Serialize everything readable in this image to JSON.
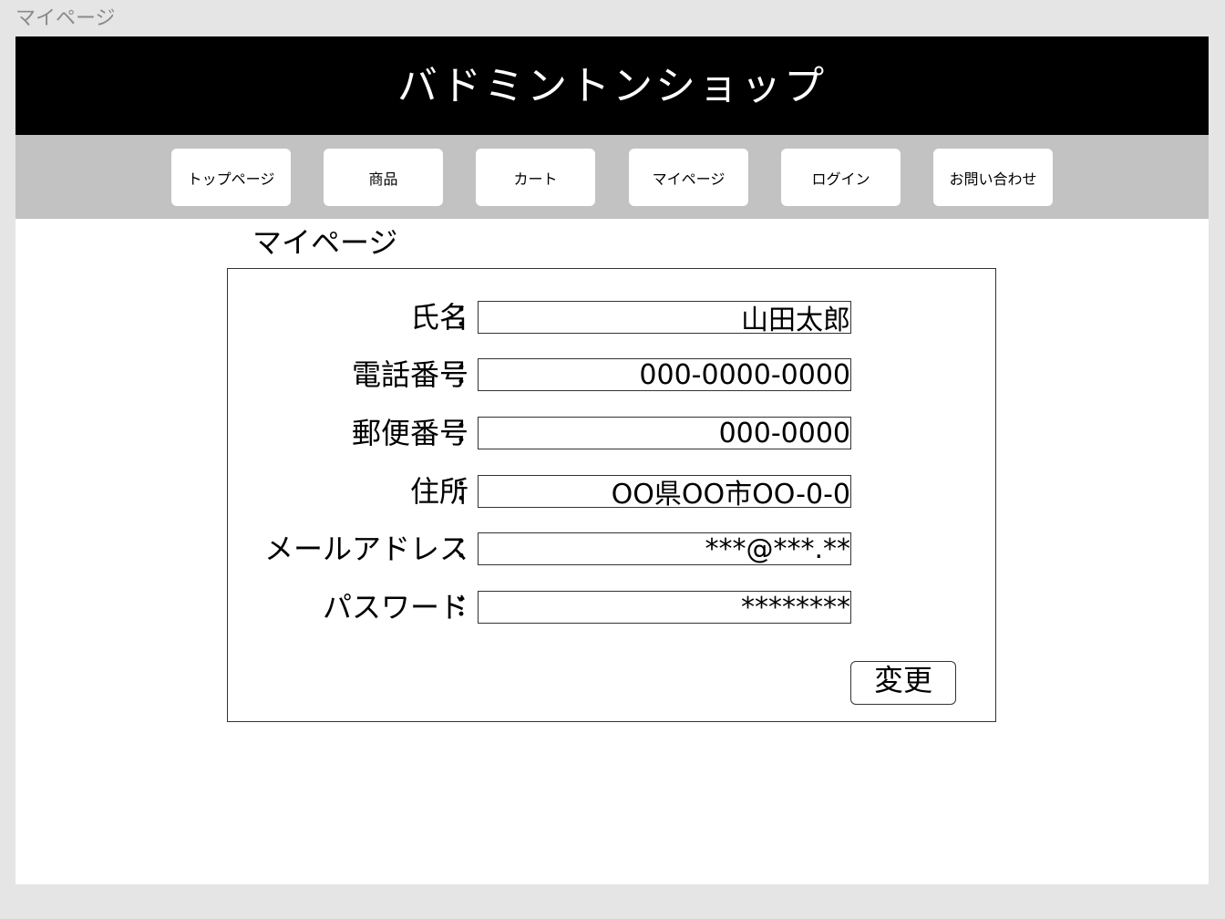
{
  "frame": {
    "label": "マイページ"
  },
  "header": {
    "title": "バドミントンショップ"
  },
  "nav": {
    "items": [
      {
        "label": "トップページ"
      },
      {
        "label": "商品"
      },
      {
        "label": "カート"
      },
      {
        "label": "マイページ"
      },
      {
        "label": "ログイン"
      },
      {
        "label": "お問い合わせ"
      }
    ]
  },
  "main": {
    "heading": "マイページ",
    "colon": "：",
    "fields": [
      {
        "label": "氏名",
        "value": "山田太郎"
      },
      {
        "label": "電話番号",
        "value": "000-0000-0000"
      },
      {
        "label": "郵便番号",
        "value": "000-0000"
      },
      {
        "label": "住所",
        "value": "OO県OO市OO-0-0"
      },
      {
        "label": "メールアドレス",
        "value": "***@***.**"
      },
      {
        "label": "パスワード",
        "value": "********"
      }
    ],
    "change_button_label": "変更"
  },
  "colors": {
    "header_bg": "#000000",
    "nav_bg": "#c2c2c2",
    "canvas_bg": "#e5e5e5",
    "content_bg": "#ffffff"
  }
}
